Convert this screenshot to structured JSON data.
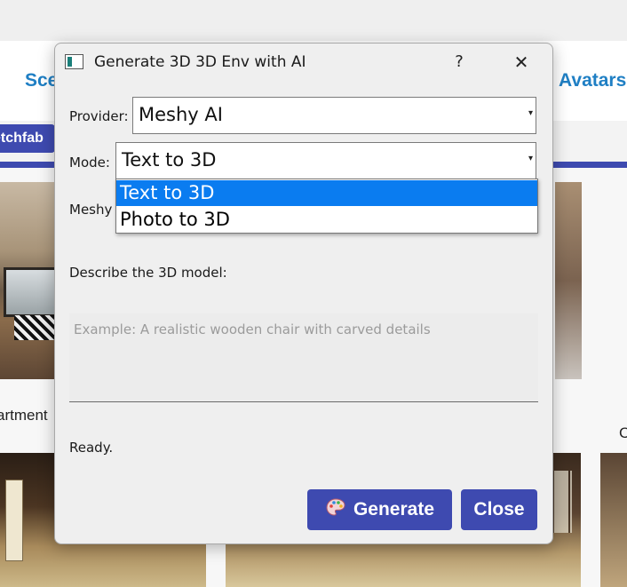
{
  "background": {
    "tabs": {
      "scenes": "Sce",
      "avatars": "Avatars"
    },
    "sketchfab_button": "etchfab",
    "apartment_label": "artment",
    "right_label": "C"
  },
  "dialog": {
    "title": "Generate 3D 3D Env with AI",
    "help_label": "?",
    "close_glyph": "✕",
    "provider": {
      "label": "Provider:",
      "value": "Meshy AI"
    },
    "mode": {
      "label": "Mode:",
      "value": "Text to 3D",
      "options": [
        "Text to 3D",
        "Photo to 3D"
      ],
      "selected_index": 0
    },
    "meshy_info_partial": "Meshy",
    "describe_label": "Describe the 3D model:",
    "description": {
      "value": "",
      "placeholder": "Example: A realistic wooden chair with carved details"
    },
    "status": "Ready.",
    "buttons": {
      "generate": "Generate",
      "close": "Close"
    }
  },
  "colors": {
    "accent": "#3e4ab0",
    "link": "#1f7fc4",
    "selection": "#0a7cf0"
  },
  "icons": [
    "palette-icon",
    "app-window-icon",
    "dropdown-arrow-icon"
  ]
}
